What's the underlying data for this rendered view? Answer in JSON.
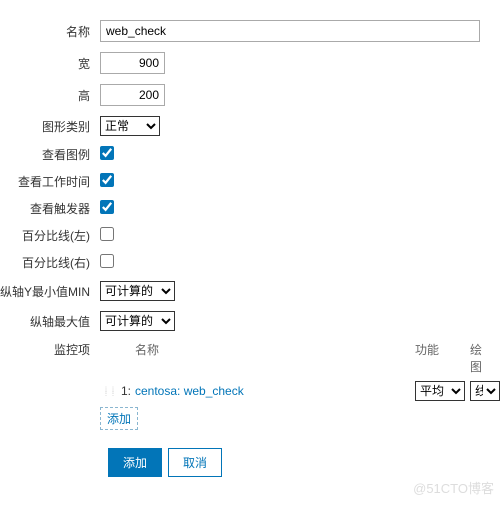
{
  "labels": {
    "name": "名称",
    "width": "宽",
    "height": "高",
    "graph_type": "图形类别",
    "show_legend": "查看图例",
    "show_working_time": "查看工作时间",
    "show_triggers": "查看触发器",
    "percentile_left": "百分比线(左)",
    "percentile_right": "百分比线(右)",
    "y_min": "纵轴Y最小值MIN",
    "y_max": "纵轴最大值",
    "items": "监控项"
  },
  "values": {
    "name": "web_check",
    "width": "900",
    "height": "200",
    "graph_type": "正常",
    "show_legend": true,
    "show_working_time": true,
    "show_triggers": true,
    "percentile_left": false,
    "percentile_right": false,
    "y_min": "可计算的",
    "y_max": "可计算的"
  },
  "items_section": {
    "columns": {
      "name": "名称",
      "func": "功能",
      "draw": "绘图"
    },
    "rows": [
      {
        "index": "1:",
        "name": "centosa: web_check",
        "func": "平均",
        "draw": "线"
      }
    ],
    "add_small": "添加"
  },
  "actions": {
    "submit": "添加",
    "cancel": "取消"
  },
  "watermark": "@51CTO博客"
}
